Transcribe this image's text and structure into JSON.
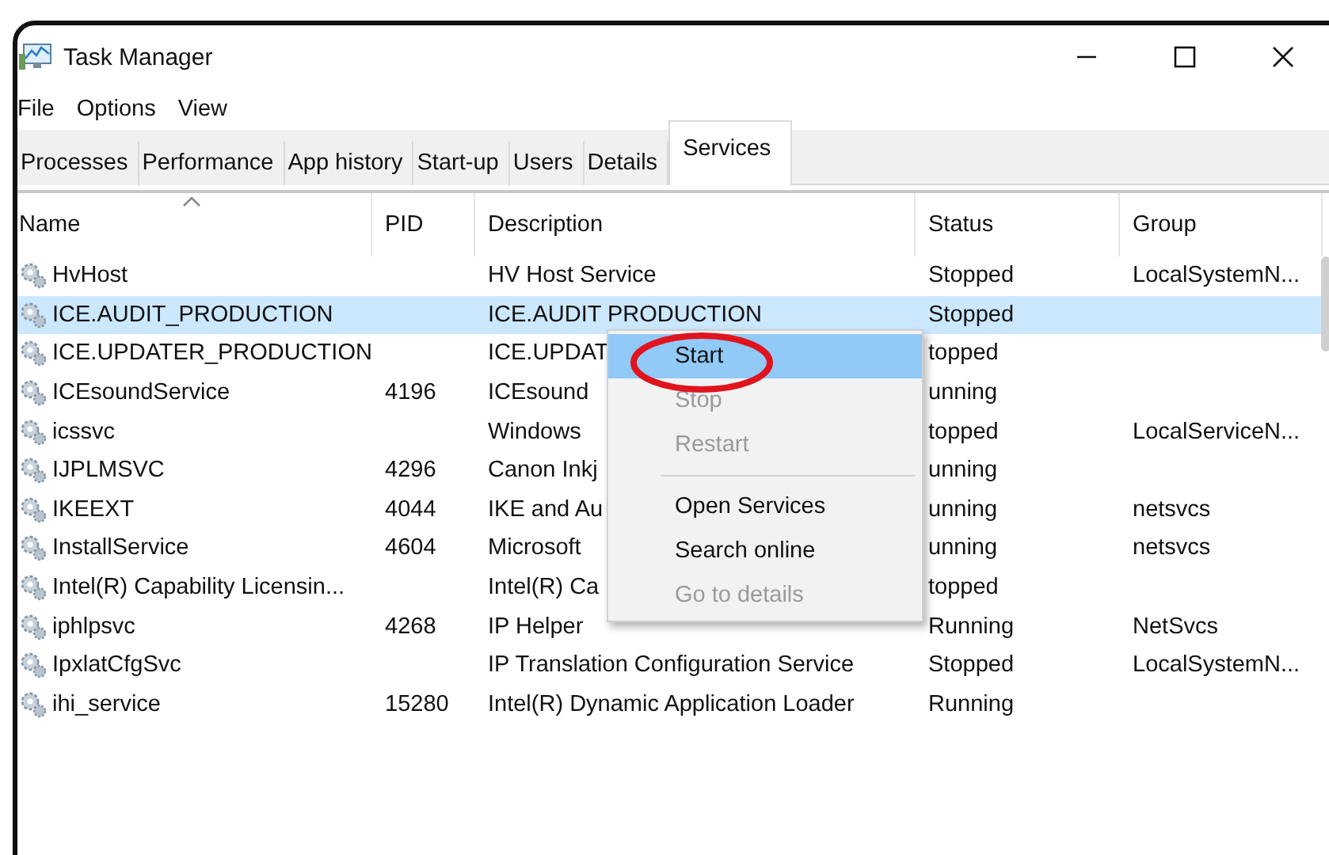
{
  "window": {
    "title": "Task Manager"
  },
  "menu_bar": [
    "File",
    "Options",
    "View"
  ],
  "tabs": [
    {
      "label": "Processes",
      "selected": false
    },
    {
      "label": "Performance",
      "selected": false
    },
    {
      "label": "App history",
      "selected": false
    },
    {
      "label": "Start-up",
      "selected": false
    },
    {
      "label": "Users",
      "selected": false
    },
    {
      "label": "Details",
      "selected": false
    },
    {
      "label": "Services",
      "selected": true
    }
  ],
  "table": {
    "columns": [
      "Name",
      "PID",
      "Description",
      "Status",
      "Group"
    ],
    "rows": [
      {
        "name": "HvHost",
        "pid": "",
        "description": "HV Host Service",
        "status": "Stopped",
        "group": "LocalSystemN...",
        "selected": false
      },
      {
        "name": "ICE.AUDIT_PRODUCTION",
        "pid": "",
        "description": "ICE.AUDIT PRODUCTION",
        "status": "Stopped",
        "group": "",
        "selected": true
      },
      {
        "name": "ICE.UPDATER_PRODUCTION",
        "pid": "",
        "description": "ICE.UPDAT",
        "status": "topped",
        "group": "",
        "selected": false
      },
      {
        "name": "ICEsoundService",
        "pid": "4196",
        "description": "ICEsound",
        "status": "unning",
        "group": "",
        "selected": false
      },
      {
        "name": "icssvc",
        "pid": "",
        "description": "Windows",
        "status": "topped",
        "group": "LocalServiceN...",
        "selected": false
      },
      {
        "name": "IJPLMSVC",
        "pid": "4296",
        "description": "Canon Inkj",
        "status": "unning",
        "group": "",
        "selected": false
      },
      {
        "name": "IKEEXT",
        "pid": "4044",
        "description": "IKE and Au",
        "status": "unning",
        "group": "netsvcs",
        "selected": false
      },
      {
        "name": "InstallService",
        "pid": "4604",
        "description": "Microsoft",
        "status": "unning",
        "group": "netsvcs",
        "selected": false
      },
      {
        "name": "Intel(R) Capability Licensin...",
        "pid": "",
        "description": "Intel(R) Ca",
        "status": "topped",
        "group": "",
        "selected": false
      },
      {
        "name": "iphlpsvc",
        "pid": "4268",
        "description": "IP Helper",
        "status": "Running",
        "group": "NetSvcs",
        "selected": false
      },
      {
        "name": "IpxlatCfgSvc",
        "pid": "",
        "description": "IP Translation Configuration Service",
        "status": "Stopped",
        "group": "LocalSystemN...",
        "selected": false
      },
      {
        "name": "ihi_service",
        "pid": "15280",
        "description": "Intel(R) Dynamic Application Loader",
        "status": "Running",
        "group": "",
        "selected": false
      }
    ]
  },
  "context_menu": {
    "items": [
      {
        "kind": "item",
        "label": "Start",
        "selected": true,
        "disabled": false
      },
      {
        "kind": "item",
        "label": "Stop",
        "selected": false,
        "disabled": true
      },
      {
        "kind": "item",
        "label": "Restart",
        "selected": false,
        "disabled": true
      },
      {
        "kind": "separator"
      },
      {
        "kind": "item",
        "label": "Open Services",
        "selected": false,
        "disabled": false
      },
      {
        "kind": "item",
        "label": "Search online",
        "selected": false,
        "disabled": false
      },
      {
        "kind": "item",
        "label": "Go to details",
        "selected": false,
        "disabled": true
      }
    ]
  }
}
